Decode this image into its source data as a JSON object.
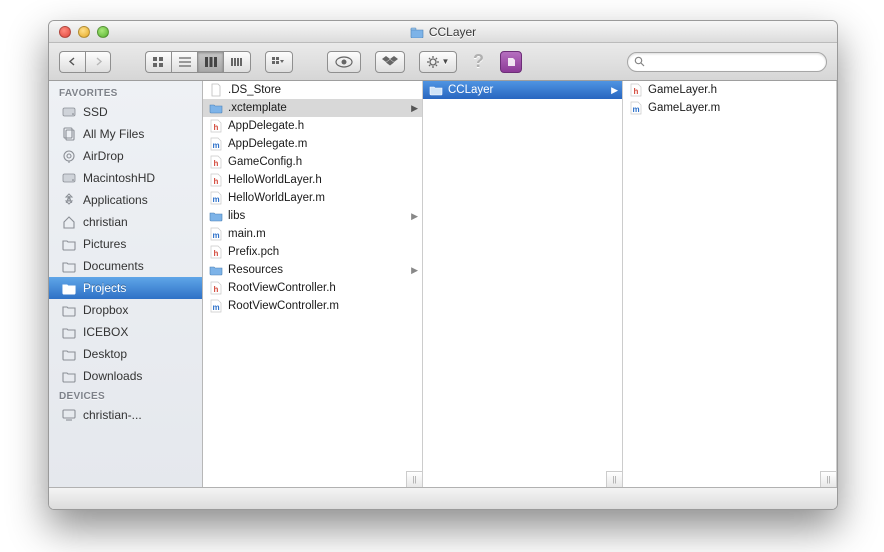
{
  "window": {
    "title": "CCLayer"
  },
  "sidebar": {
    "sections": [
      {
        "header": "FAVORITES",
        "items": [
          {
            "label": "SSD",
            "icon": "hdd"
          },
          {
            "label": "All My Files",
            "icon": "allfiles"
          },
          {
            "label": "AirDrop",
            "icon": "airdrop"
          },
          {
            "label": "MacintoshHD",
            "icon": "hdd"
          },
          {
            "label": "Applications",
            "icon": "apps"
          },
          {
            "label": "christian",
            "icon": "home"
          },
          {
            "label": "Pictures",
            "icon": "folder"
          },
          {
            "label": "Documents",
            "icon": "folder"
          },
          {
            "label": "Projects",
            "icon": "folder",
            "selected": true
          },
          {
            "label": "Dropbox",
            "icon": "folder"
          },
          {
            "label": "ICEBOX",
            "icon": "folder"
          },
          {
            "label": "Desktop",
            "icon": "folder"
          },
          {
            "label": "Downloads",
            "icon": "folder"
          }
        ]
      },
      {
        "header": "DEVICES",
        "items": [
          {
            "label": "christian-...",
            "icon": "computer"
          }
        ]
      }
    ]
  },
  "columns": [
    {
      "items": [
        {
          "label": ".DS_Store",
          "icon": "doc"
        },
        {
          "label": ".xctemplate",
          "icon": "folder-sm",
          "folder": true,
          "selected": "gray"
        },
        {
          "label": "AppDelegate.h",
          "icon": "h"
        },
        {
          "label": "AppDelegate.m",
          "icon": "m"
        },
        {
          "label": "GameConfig.h",
          "icon": "h"
        },
        {
          "label": "HelloWorldLayer.h",
          "icon": "h"
        },
        {
          "label": "HelloWorldLayer.m",
          "icon": "m"
        },
        {
          "label": "libs",
          "icon": "folder-sm",
          "folder": true
        },
        {
          "label": "main.m",
          "icon": "m"
        },
        {
          "label": "Prefix.pch",
          "icon": "h"
        },
        {
          "label": "Resources",
          "icon": "folder-sm",
          "folder": true
        },
        {
          "label": "RootViewController.h",
          "icon": "h"
        },
        {
          "label": "RootViewController.m",
          "icon": "m"
        }
      ]
    },
    {
      "items": [
        {
          "label": "CCLayer",
          "icon": "folder-sm",
          "folder": true,
          "selected": "blue"
        }
      ]
    },
    {
      "items": [
        {
          "label": "GameLayer.h",
          "icon": "h"
        },
        {
          "label": "GameLayer.m",
          "icon": "m"
        }
      ]
    }
  ],
  "search": {
    "placeholder": ""
  }
}
